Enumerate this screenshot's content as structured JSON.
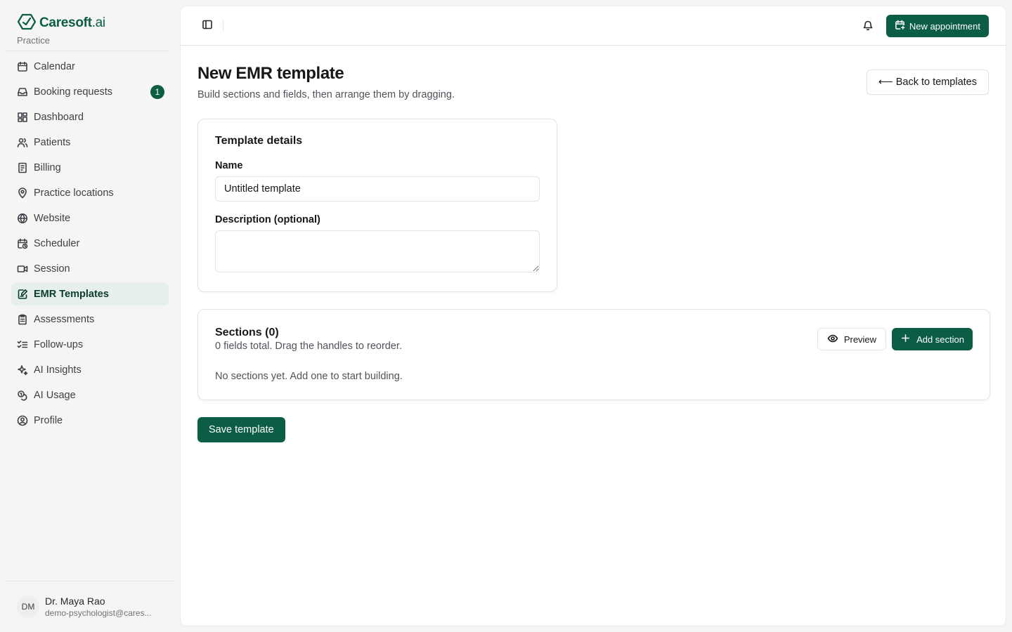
{
  "brand": {
    "name": "Caresoft",
    "suffix": ".ai",
    "subtitle": "Practice"
  },
  "sidebar": {
    "items": [
      {
        "label": "Calendar",
        "icon": "calendar-icon"
      },
      {
        "label": "Booking requests",
        "icon": "inbox-icon",
        "badge": "1"
      },
      {
        "label": "Dashboard",
        "icon": "dashboard-icon"
      },
      {
        "label": "Patients",
        "icon": "users-icon"
      },
      {
        "label": "Billing",
        "icon": "receipt-icon"
      },
      {
        "label": "Practice locations",
        "icon": "map-pin-icon"
      },
      {
        "label": "Website",
        "icon": "globe-icon"
      },
      {
        "label": "Scheduler",
        "icon": "calendar-clock-icon"
      },
      {
        "label": "Session",
        "icon": "video-icon"
      },
      {
        "label": "EMR Templates",
        "icon": "file-edit-icon",
        "active": true
      },
      {
        "label": "Assessments",
        "icon": "clipboard-icon"
      },
      {
        "label": "Follow-ups",
        "icon": "list-check-icon"
      },
      {
        "label": "AI Insights",
        "icon": "sparkles-icon"
      },
      {
        "label": "AI Usage",
        "icon": "coins-icon"
      },
      {
        "label": "Profile",
        "icon": "user-circle-icon"
      }
    ]
  },
  "user": {
    "initials": "DM",
    "name": "Dr. Maya Rao",
    "email": "demo-psychologist@cares..."
  },
  "topbar": {
    "new_appointment_label": "New appointment"
  },
  "page": {
    "title": "New EMR template",
    "subtitle": "Build sections and fields, then arrange them by dragging.",
    "back_label": "⟵ Back to templates"
  },
  "details": {
    "title": "Template details",
    "name_label": "Name",
    "name_value": "Untitled template",
    "description_label": "Description (optional)",
    "description_value": ""
  },
  "sections": {
    "title": "Sections (0)",
    "subtitle": "0 fields total. Drag the handles to reorder.",
    "empty_text": "No sections yet. Add one to start building.",
    "preview_label": "Preview",
    "add_label": "Add section"
  },
  "save_label": "Save template",
  "colors": {
    "brand": "#0b5d45",
    "active_bg": "#e6efe9"
  }
}
